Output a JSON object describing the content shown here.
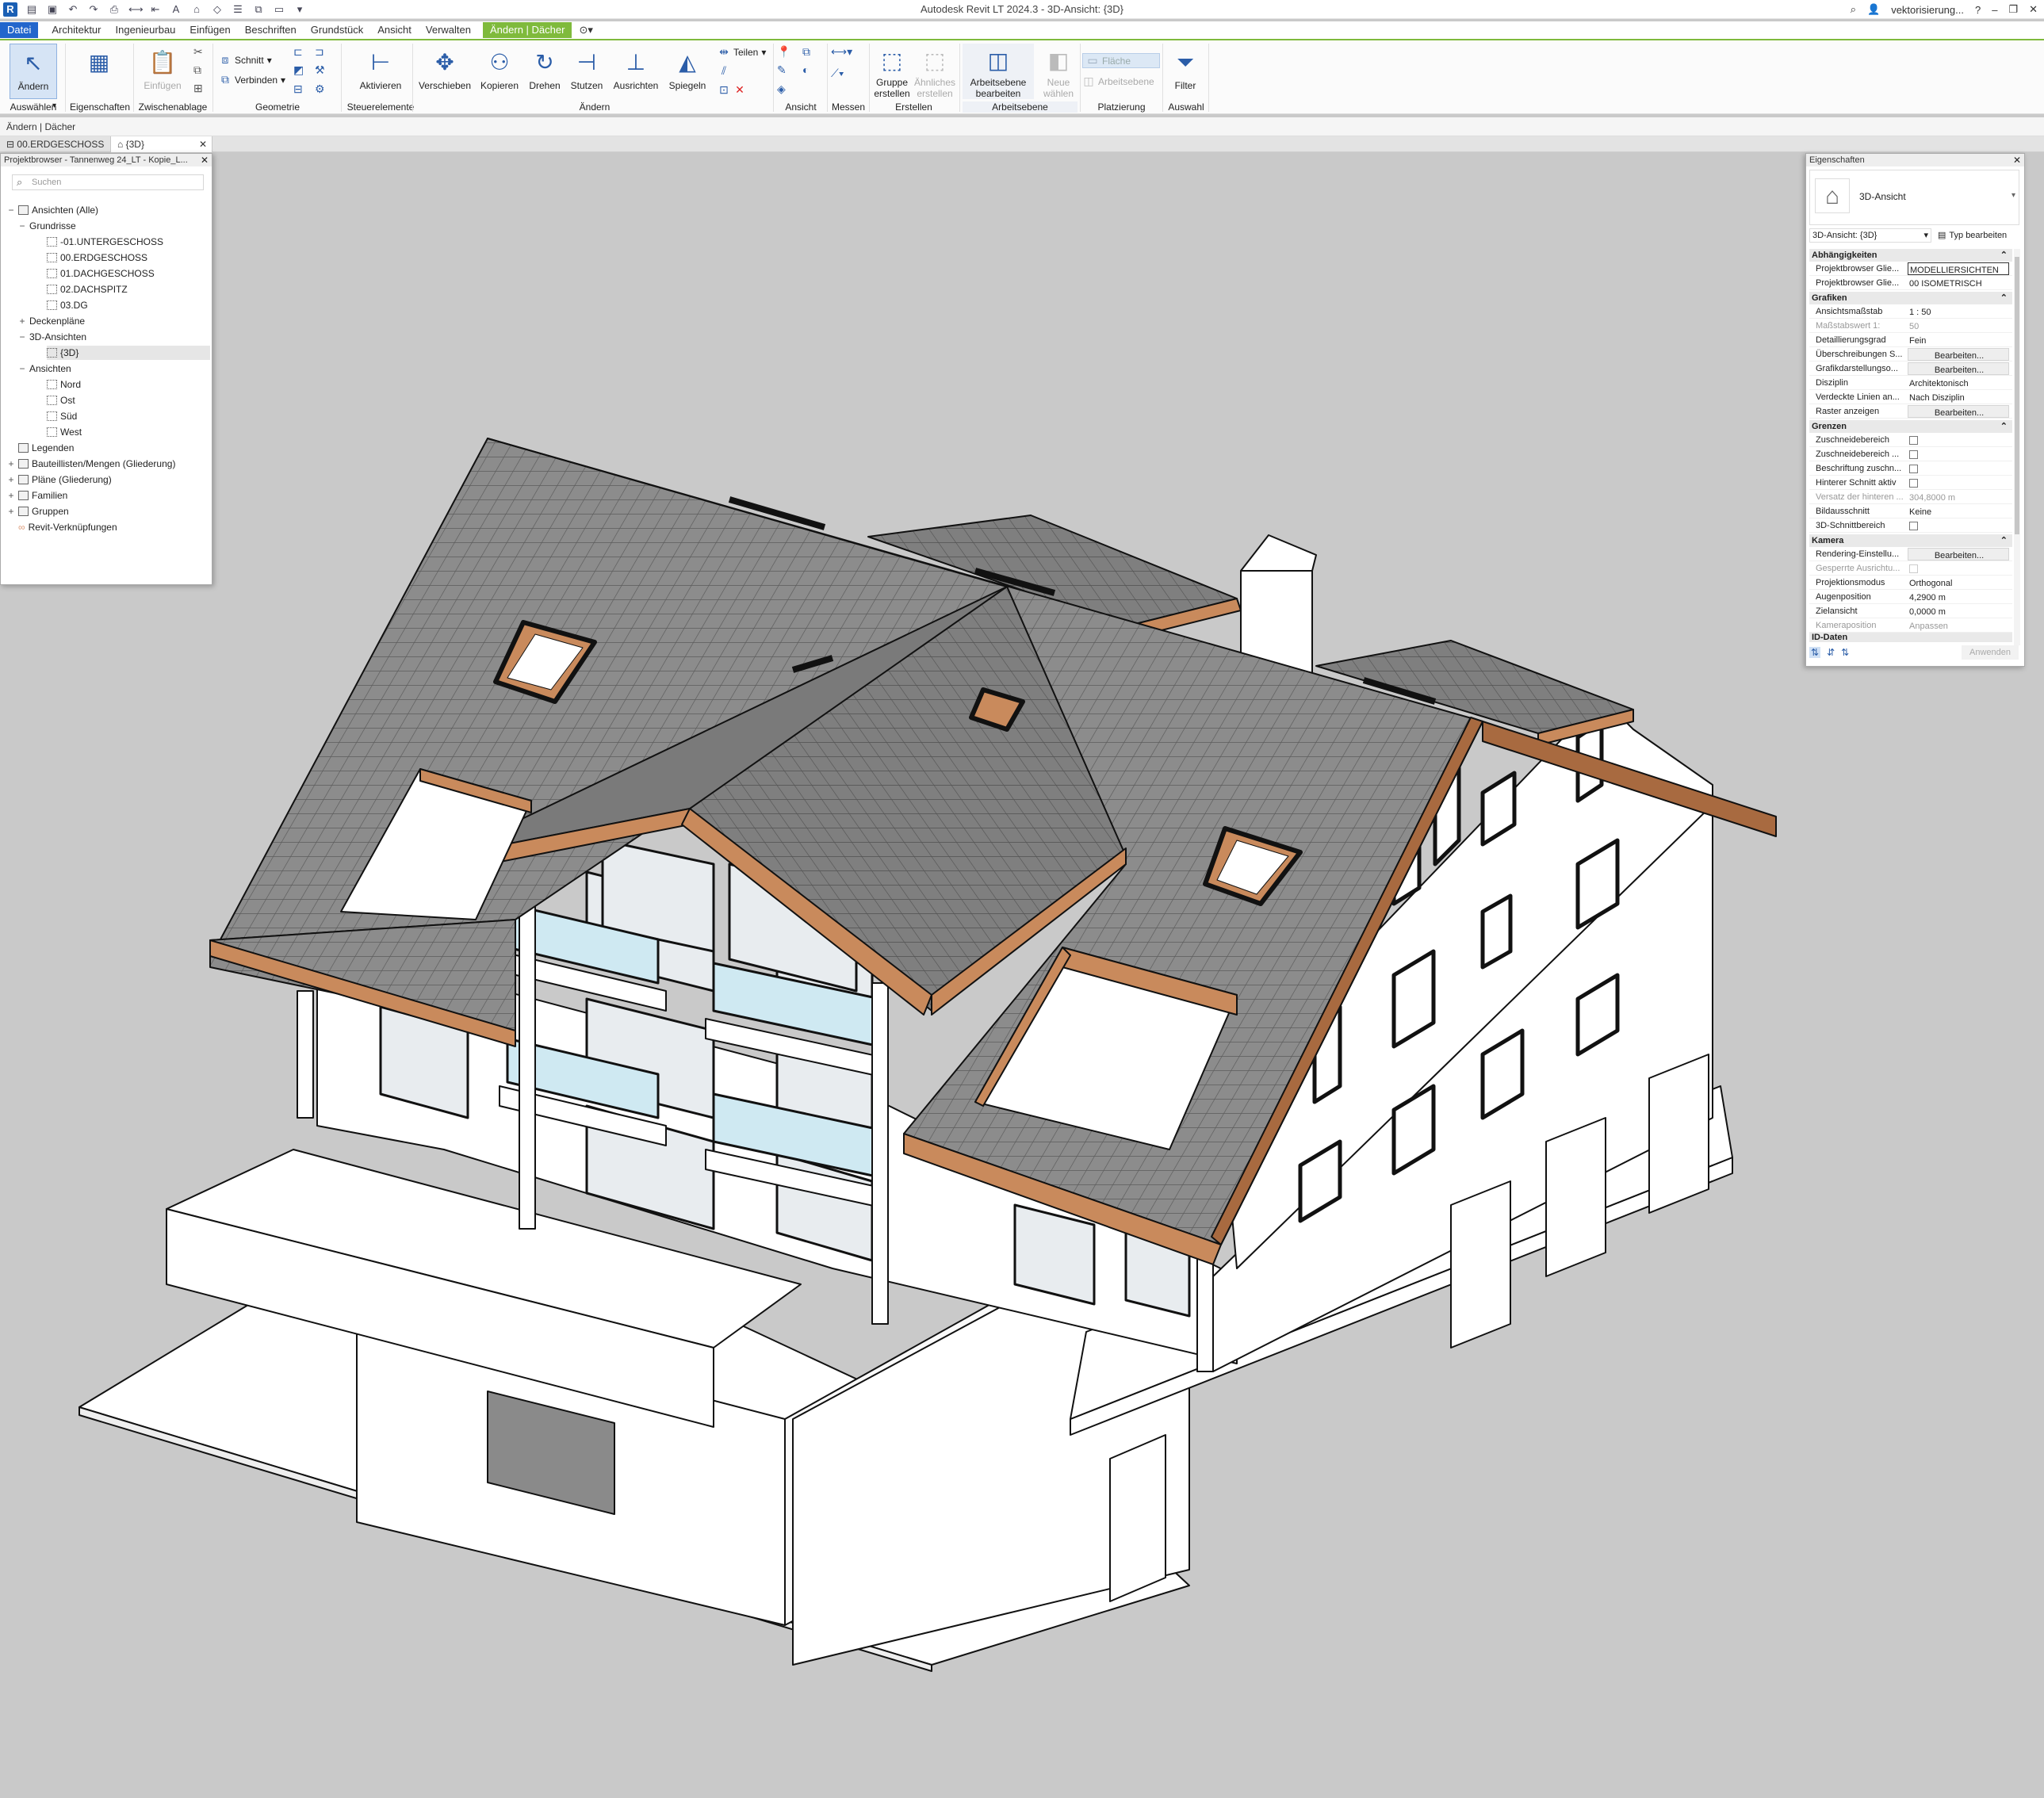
{
  "app": {
    "title": "Autodesk Revit LT 2024.3 - 3D-Ansicht: {3D}",
    "user": "vektorisierung...",
    "logo": "R"
  },
  "menu": {
    "tabs": [
      "Datei",
      "Architektur",
      "Ingenieurbau",
      "Einfügen",
      "Beschriften",
      "Grundstück",
      "Ansicht",
      "Verwalten"
    ],
    "context_tab": "Ändern | Dächer"
  },
  "ribbon": {
    "buttons": {
      "aendern": "Ändern",
      "einfuegen": "Einfügen",
      "schnitt": "Schnitt",
      "verbinden": "Verbinden",
      "aktivieren": "Aktivieren",
      "verschieben": "Verschieben",
      "kopieren": "Kopieren",
      "drehen": "Drehen",
      "stutzen": "Stutzen",
      "ausrichten": "Ausrichten",
      "spiegeln": "Spiegeln",
      "teilen": "Teilen",
      "gruppe": "Gruppe",
      "erstellen": "erstellen",
      "aehnliche": "Ähnliches",
      "aehnliche2": "erstellen",
      "arbeitsebene": "Arbeitsebene",
      "bearbeiten": "bearbeiten",
      "neue": "Neue",
      "waehlen": "wählen",
      "flaeche": "Fläche",
      "arbeitsebene_small": "Arbeitsebene",
      "filter": "Filter"
    },
    "panels": [
      "Auswählen",
      "Eigenschaften",
      "Zwischenablage",
      "Geometrie",
      "Steuerelemente",
      "Ändern",
      "Ansicht",
      "Messen",
      "Erstellen",
      "Arbeitsebene",
      "Platzierung",
      "Auswahl"
    ]
  },
  "options_bar": "Ändern | Dächer",
  "view_tabs": [
    "00.ERDGESCHOSS",
    "{3D}"
  ],
  "project_browser": {
    "title": "Projektbrowser - Tannenweg 24_LT - Kopie_L...",
    "search_placeholder": "Suchen",
    "items": [
      {
        "label": "Ansichten (Alle)"
      },
      {
        "label": "Grundrisse"
      },
      {
        "label": "-01.UNTERGESCHOSS"
      },
      {
        "label": "00.ERDGESCHOSS"
      },
      {
        "label": "01.DACHGESCHOSS"
      },
      {
        "label": "02.DACHSPITZ"
      },
      {
        "label": "03.DG"
      },
      {
        "label": "Deckenpläne"
      },
      {
        "label": "3D-Ansichten"
      },
      {
        "label": "{3D}"
      },
      {
        "label": "Ansichten"
      },
      {
        "label": "Nord"
      },
      {
        "label": "Ost"
      },
      {
        "label": "Süd"
      },
      {
        "label": "West"
      },
      {
        "label": "Legenden"
      },
      {
        "label": "Bauteillisten/Mengen (Gliederung)"
      },
      {
        "label": "Pläne (Gliederung)"
      },
      {
        "label": "Familien"
      },
      {
        "label": "Gruppen"
      },
      {
        "label": "Revit-Verknüpfungen"
      }
    ]
  },
  "properties": {
    "title": "Eigenschaften",
    "type_name": "3D-Ansicht",
    "instance_selector": "3D-Ansicht: {3D}",
    "edit_type": "Typ bearbeiten",
    "groups": {
      "abh": "Abhängigkeiten",
      "graf": "Grafiken",
      "grenzen": "Grenzen",
      "kamera": "Kamera",
      "daten": "ID-Daten"
    },
    "rows": [
      {
        "k": "Projektbrowser Glie...",
        "v": "MODELLIERSICHTEN"
      },
      {
        "k": "Projektbrowser Glie...",
        "v": "00 ISOMETRISCH"
      },
      {
        "k": "Ansichtsmaßstab",
        "v": "1 : 50"
      },
      {
        "k": "Maßstabswert 1:",
        "v": "50"
      },
      {
        "k": "Detaillierungsgrad",
        "v": "Fein"
      },
      {
        "k": "Überschreibungen S...",
        "v": "Bearbeiten..."
      },
      {
        "k": "Grafikdarstellungso...",
        "v": "Bearbeiten..."
      },
      {
        "k": "Disziplin",
        "v": "Architektonisch"
      },
      {
        "k": "Verdeckte Linien an...",
        "v": "Nach Disziplin"
      },
      {
        "k": "Raster anzeigen",
        "v": "Bearbeiten..."
      },
      {
        "k": "Zuschneidebereich",
        "v": ""
      },
      {
        "k": "Zuschneidebereich ...",
        "v": ""
      },
      {
        "k": "Beschriftung zuschn...",
        "v": ""
      },
      {
        "k": "Hinterer Schnitt aktiv",
        "v": ""
      },
      {
        "k": "Versatz der hinteren ...",
        "v": "304,8000 m"
      },
      {
        "k": "Bildausschnitt",
        "v": "Keine"
      },
      {
        "k": "3D-Schnittbereich",
        "v": ""
      },
      {
        "k": "Rendering-Einstellu...",
        "v": "Bearbeiten..."
      },
      {
        "k": "Gesperrte Ausrichtu...",
        "v": ""
      },
      {
        "k": "Projektionsmodus",
        "v": "Orthogonal"
      },
      {
        "k": "Augenposition",
        "v": "4,2900 m"
      },
      {
        "k": "Zielansicht",
        "v": "0,0000 m"
      },
      {
        "k": "Kameraposition",
        "v": "Anpassen"
      }
    ],
    "apply": "Anwenden"
  },
  "colors": {
    "accent": "#7fba3c",
    "file_tab": "#2266cc",
    "roof": "#8e8e8e",
    "fascia": "#c98a5c",
    "wall": "#ffffff",
    "background": "#c9c9c9"
  }
}
